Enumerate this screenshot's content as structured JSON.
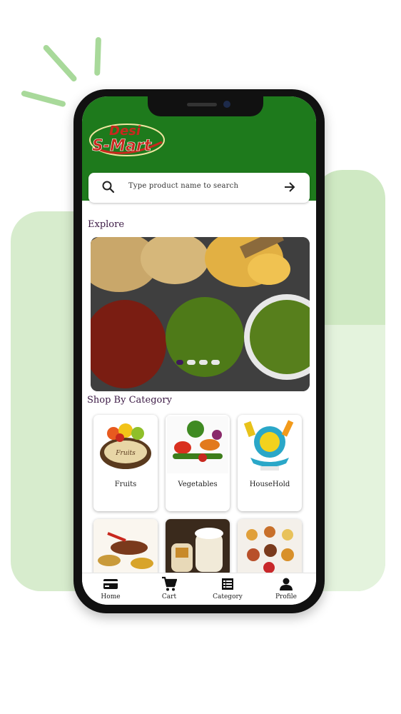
{
  "app": {
    "logo_line1": "Desi",
    "logo_line2": "S-Mart"
  },
  "search": {
    "placeholder": "Type product name to search"
  },
  "sections": {
    "explore": "Explore",
    "shop_by_category": "Shop By Category"
  },
  "banner": {
    "slides": 4,
    "active_slide": 1
  },
  "categories": [
    {
      "label": "Fruits",
      "icon": "fruit-basket-image"
    },
    {
      "label": "Vegetables",
      "icon": "vegetables-image"
    },
    {
      "label": "HouseHold",
      "icon": "household-cleaning-image"
    },
    {
      "label": "",
      "icon": "spices-image"
    },
    {
      "label": "",
      "icon": "pickles-jars-image"
    },
    {
      "label": "",
      "icon": "sweets-bowls-image"
    }
  ],
  "nav": {
    "home": "Home",
    "cart": "Cart",
    "category": "Category",
    "profile": "Profile"
  },
  "colors": {
    "brand_green": "#1e7a1c",
    "logo_red": "#c8281e",
    "heading_purple": "#3c1a45",
    "accent_light_green": "#cfe9c3"
  }
}
